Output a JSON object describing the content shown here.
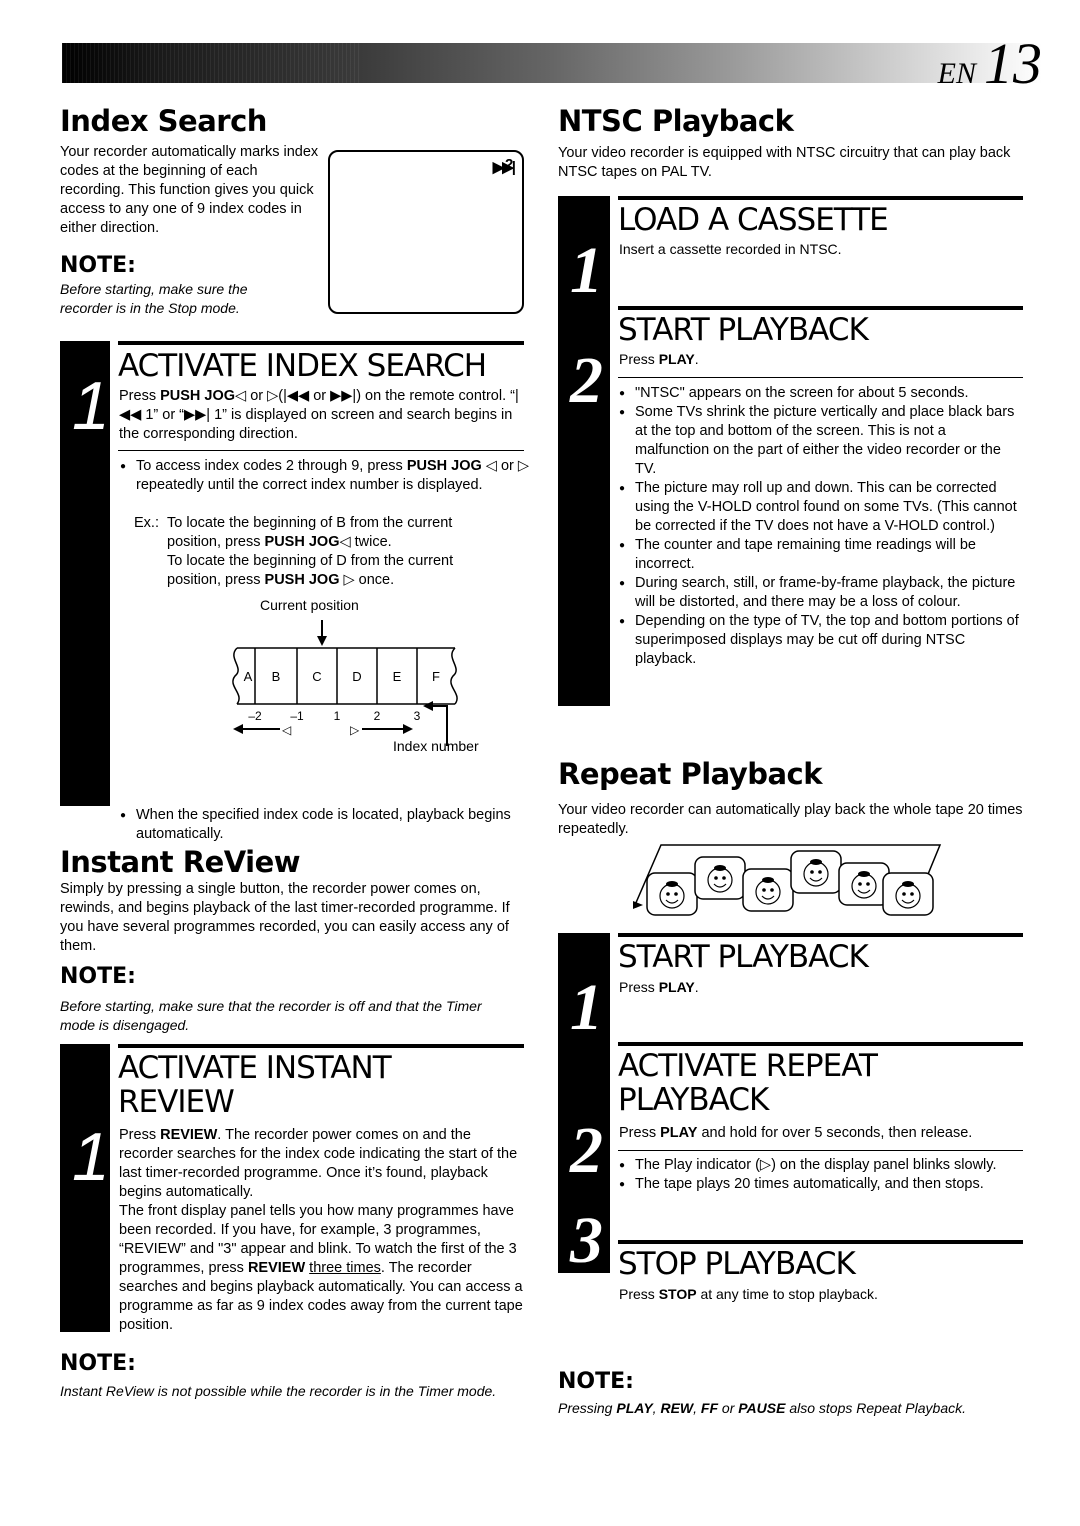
{
  "header": {
    "lang": "EN",
    "page_number": "13"
  },
  "index_search": {
    "title": "Index Search",
    "intro": "Your recorder automatically marks index codes at the beginning of each recording. This function gives you quick access to any one of 9 index codes in either direction.",
    "note_heading": "NOTE:",
    "note_text": "Before starting, make sure the recorder is in the Stop mode.",
    "screen_display": {
      "icon": "skip-forward-icon",
      "glyph": "▶▶|",
      "value": "2"
    },
    "step1": {
      "number": "1",
      "title": "ACTIVATE INDEX SEARCH",
      "text_parts": [
        "Press ",
        "PUSH JOG",
        "◁ or ▷(|◀◀ or ▶▶|) on the remote control. “|◀◀ 1” or “▶▶| 1” is displayed on screen and search begins in the corresponding direction."
      ],
      "bullet1_parts": [
        "To access index codes 2 through 9, press ",
        "PUSH JOG",
        " ◁ or ▷  repeatedly until the correct index number is displayed."
      ],
      "example_label": "Ex.:",
      "example1_parts": [
        "To locate the beginning of B from the current position, press  ",
        "PUSH JOG",
        "◁ twice."
      ],
      "example2_parts": [
        "To locate the beginning of D from the current position, press ",
        "PUSH JOG",
        " ▷ once."
      ],
      "diagram": {
        "current_position_label": "Current position",
        "segments": [
          "A",
          "B",
          "C",
          "D",
          "E",
          "F"
        ],
        "index_numbers": [
          "–2",
          "–1",
          "1",
          "2",
          "3"
        ],
        "back_symbol": "◁",
        "forward_symbol": "▷",
        "index_number_label": "Index number"
      },
      "bullet2": "When the specified index code is located, playback begins automatically."
    }
  },
  "instant_review": {
    "title": "Instant ReView",
    "intro": "Simply by pressing a single button, the recorder power comes on, rewinds, and begins playback of the last timer-recorded programme. If you have several programmes recorded, you can easily access any of them.",
    "note_heading": "NOTE:",
    "note_text": "Before starting, make sure that the recorder is off and that the Timer mode is disengaged.",
    "step1": {
      "number": "1",
      "title_line1": "ACTIVATE INSTANT",
      "title_line2": "REVIEW",
      "p1": [
        "Press ",
        "REVIEW",
        ". The recorder power comes on and the recorder searches for the index code indicating the start of the last timer-recorded programme. Once it’s found, playback begins automatically."
      ],
      "p2": [
        "The front display panel tells you how many programmes have been recorded. If you have, for example, 3 programmes, “REVIEW” and \"3\" appear and blink. To watch the first of the 3 programmes, press ",
        "REVIEW",
        " ",
        "three times",
        ". The recorder searches and begins playback automatically. You can access a programme as far as 9 index codes away from the current tape position."
      ]
    },
    "note2_heading": "NOTE:",
    "note2_text": "Instant ReView is not possible while the recorder is in the Timer mode."
  },
  "ntsc": {
    "title": "NTSC Playback",
    "intro": "Your video recorder is equipped with NTSC circuitry that can play back NTSC tapes on PAL TV.",
    "step1": {
      "number": "1",
      "title": "LOAD A CASSETTE",
      "text": "Insert a cassette recorded in NTSC."
    },
    "step2": {
      "number": "2",
      "title": "START PLAYBACK",
      "text_parts": [
        "Press ",
        "PLAY",
        "."
      ],
      "bullets": [
        "\"NTSC\" appears on the screen for about 5 seconds.",
        "Some TVs shrink the picture vertically and place black bars at the top and bottom of the screen. This is not a malfunction on the part of either the video recorder or the TV.",
        "The picture may roll up and down. This can be corrected using the V-HOLD control found on some TVs. (This cannot be corrected if the TV does not have a V-HOLD control.)",
        "The counter and tape remaining time readings will be incorrect.",
        "During search, still, or frame-by-frame playback, the picture will be distorted, and there may be a loss of colour.",
        "Depending on the type of TV, the top and bottom portions of superimposed displays may be cut off during NTSC playback."
      ]
    }
  },
  "repeat": {
    "title": "Repeat Playback",
    "intro": "Your video recorder can automatically play back the whole tape 20 times repeatedly.",
    "illustration": "repeat-loop-illustration",
    "step1": {
      "number": "1",
      "title": "START PLAYBACK",
      "text_parts": [
        "Press ",
        "PLAY",
        "."
      ]
    },
    "step2": {
      "number": "2",
      "title_line1": "ACTIVATE REPEAT",
      "title_line2": "PLAYBACK",
      "text_parts": [
        "Press ",
        "PLAY",
        " and hold for over 5 seconds, then release."
      ],
      "bullets": [
        "The Play indicator (▷) on the display panel blinks slowly.",
        "The tape plays 20 times automatically, and then stops."
      ]
    },
    "step3": {
      "number": "3",
      "title": "STOP PLAYBACK",
      "text_parts": [
        "Press ",
        "STOP",
        " at any time to stop playback."
      ]
    },
    "note_heading": "NOTE:",
    "note_parts": [
      "Pressing ",
      "PLAY",
      ", ",
      "REW",
      ", ",
      "FF",
      " or ",
      "PAUSE",
      " also stops Repeat Playback."
    ]
  }
}
